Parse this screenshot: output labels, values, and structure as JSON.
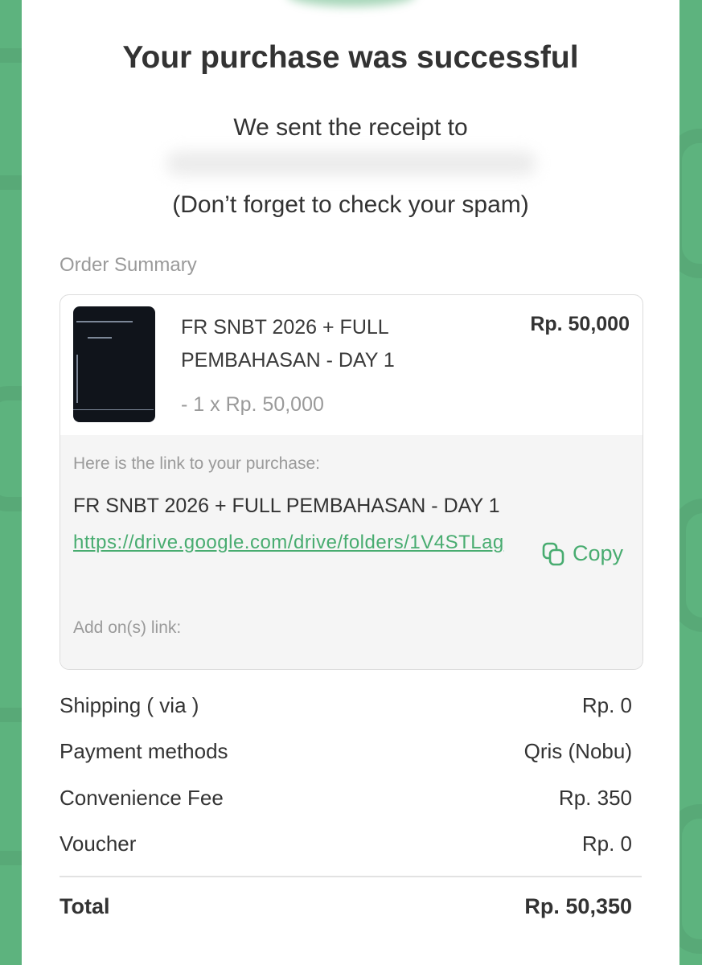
{
  "page": {
    "title": "Your purchase was successful",
    "receipt_text": "We sent the receipt to",
    "spam_note": "(Don’t forget to check your spam)"
  },
  "order_summary": {
    "label": "Order Summary",
    "item": {
      "name": "FR SNBT 2026 + FULL PEMBAHASAN - DAY 1",
      "price": "Rp. 50,000",
      "quantity_text": "- 1 x Rp. 50,000"
    },
    "purchase_link": {
      "intro": "Here is the link to your purchase:",
      "title": "FR SNBT 2026 + FULL PEMBAHASAN - DAY 1",
      "url": "https://drive.google.com/drive/folders/1V4STLag",
      "copy_label": "Copy"
    },
    "addons_label": "Add on(s) link:"
  },
  "details": [
    {
      "label": "Shipping ( via )",
      "value": "Rp. 0"
    },
    {
      "label": "Payment methods",
      "value": "Qris (Nobu)"
    },
    {
      "label": "Convenience Fee",
      "value": "Rp. 350"
    },
    {
      "label": "Voucher",
      "value": "Rp. 0"
    }
  ],
  "total": {
    "label": "Total",
    "value": "Rp. 50,350"
  },
  "colors": {
    "brand": "#5db37e",
    "link": "#48ac70",
    "text": "#333333",
    "muted": "#9a9a9a"
  },
  "icons": {
    "copy": "copy-icon"
  }
}
